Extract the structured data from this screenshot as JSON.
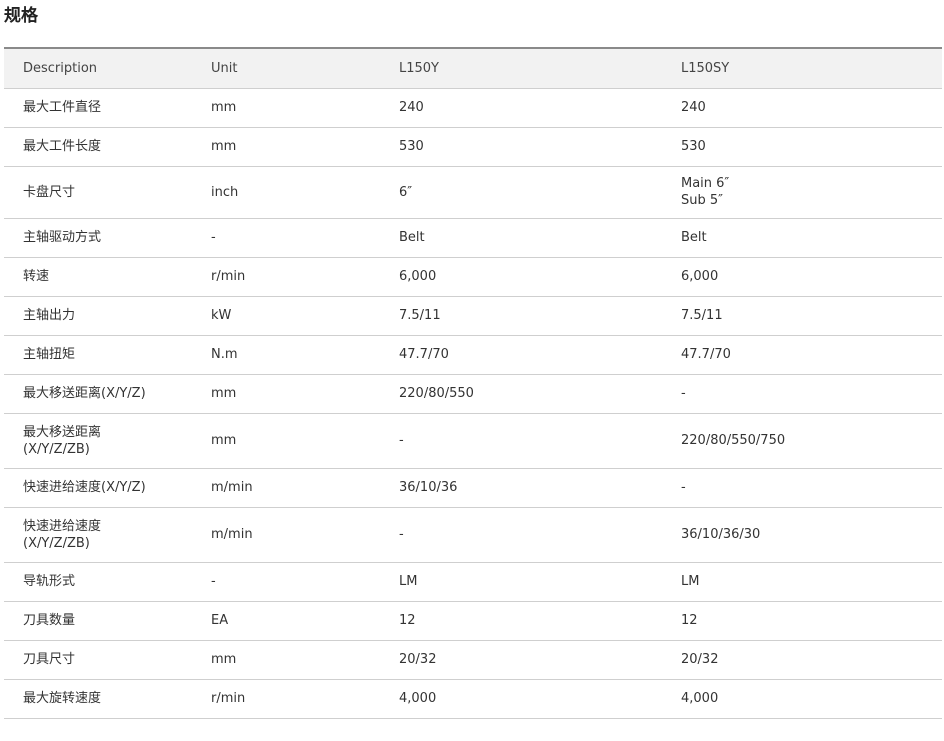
{
  "page": {
    "title": "规格"
  },
  "table": {
    "headers": [
      "Description",
      "Unit",
      "L150Y",
      "L150SY"
    ],
    "rows": [
      {
        "description": "最大工件直径",
        "unit": "mm",
        "l150y": "240",
        "l150sy": "240"
      },
      {
        "description": "最大工件长度",
        "unit": "mm",
        "l150y": "530",
        "l150sy": "530"
      },
      {
        "description": "卡盘尺寸",
        "unit": "inch",
        "l150y": "6″",
        "l150sy_line1": "Main 6″",
        "l150sy_line2": "Sub 5″"
      },
      {
        "description": "主轴驱动方式",
        "unit": "-",
        "l150y": "Belt",
        "l150sy": "Belt"
      },
      {
        "description": "转速",
        "unit": "r/min",
        "l150y": "6,000",
        "l150sy": "6,000"
      },
      {
        "description": "主轴出力",
        "unit": "kW",
        "l150y": "7.5/11",
        "l150sy": "7.5/11"
      },
      {
        "description": "主轴扭矩",
        "unit": "N.m",
        "l150y": "47.7/70",
        "l150sy": "47.7/70"
      },
      {
        "description": "最大移送距离(X/Y/Z)",
        "unit": "mm",
        "l150y": "220/80/550",
        "l150sy": "-"
      },
      {
        "description_line1": "最大移送距离",
        "description_line2": "(X/Y/Z/ZB)",
        "unit": "mm",
        "l150y": "-",
        "l150sy": "220/80/550/750"
      },
      {
        "description": "快速进给速度(X/Y/Z)",
        "unit": "m/min",
        "l150y": "36/10/36",
        "l150sy": "-"
      },
      {
        "description_line1": "快速进给速度",
        "description_line2": "(X/Y/Z/ZB)",
        "unit": "m/min",
        "l150y": "-",
        "l150sy": "36/10/36/30"
      },
      {
        "description": "导轨形式",
        "unit": "-",
        "l150y": "LM",
        "l150sy": "LM"
      },
      {
        "description": "刀具数量",
        "unit": "EA",
        "l150y": "12",
        "l150sy": "12"
      },
      {
        "description": "刀具尺寸",
        "unit": "mm",
        "l150y": "20/32",
        "l150sy": "20/32"
      },
      {
        "description": "最大旋转速度",
        "unit": "r/min",
        "l150y": "4,000",
        "l150sy": "4,000"
      }
    ]
  }
}
